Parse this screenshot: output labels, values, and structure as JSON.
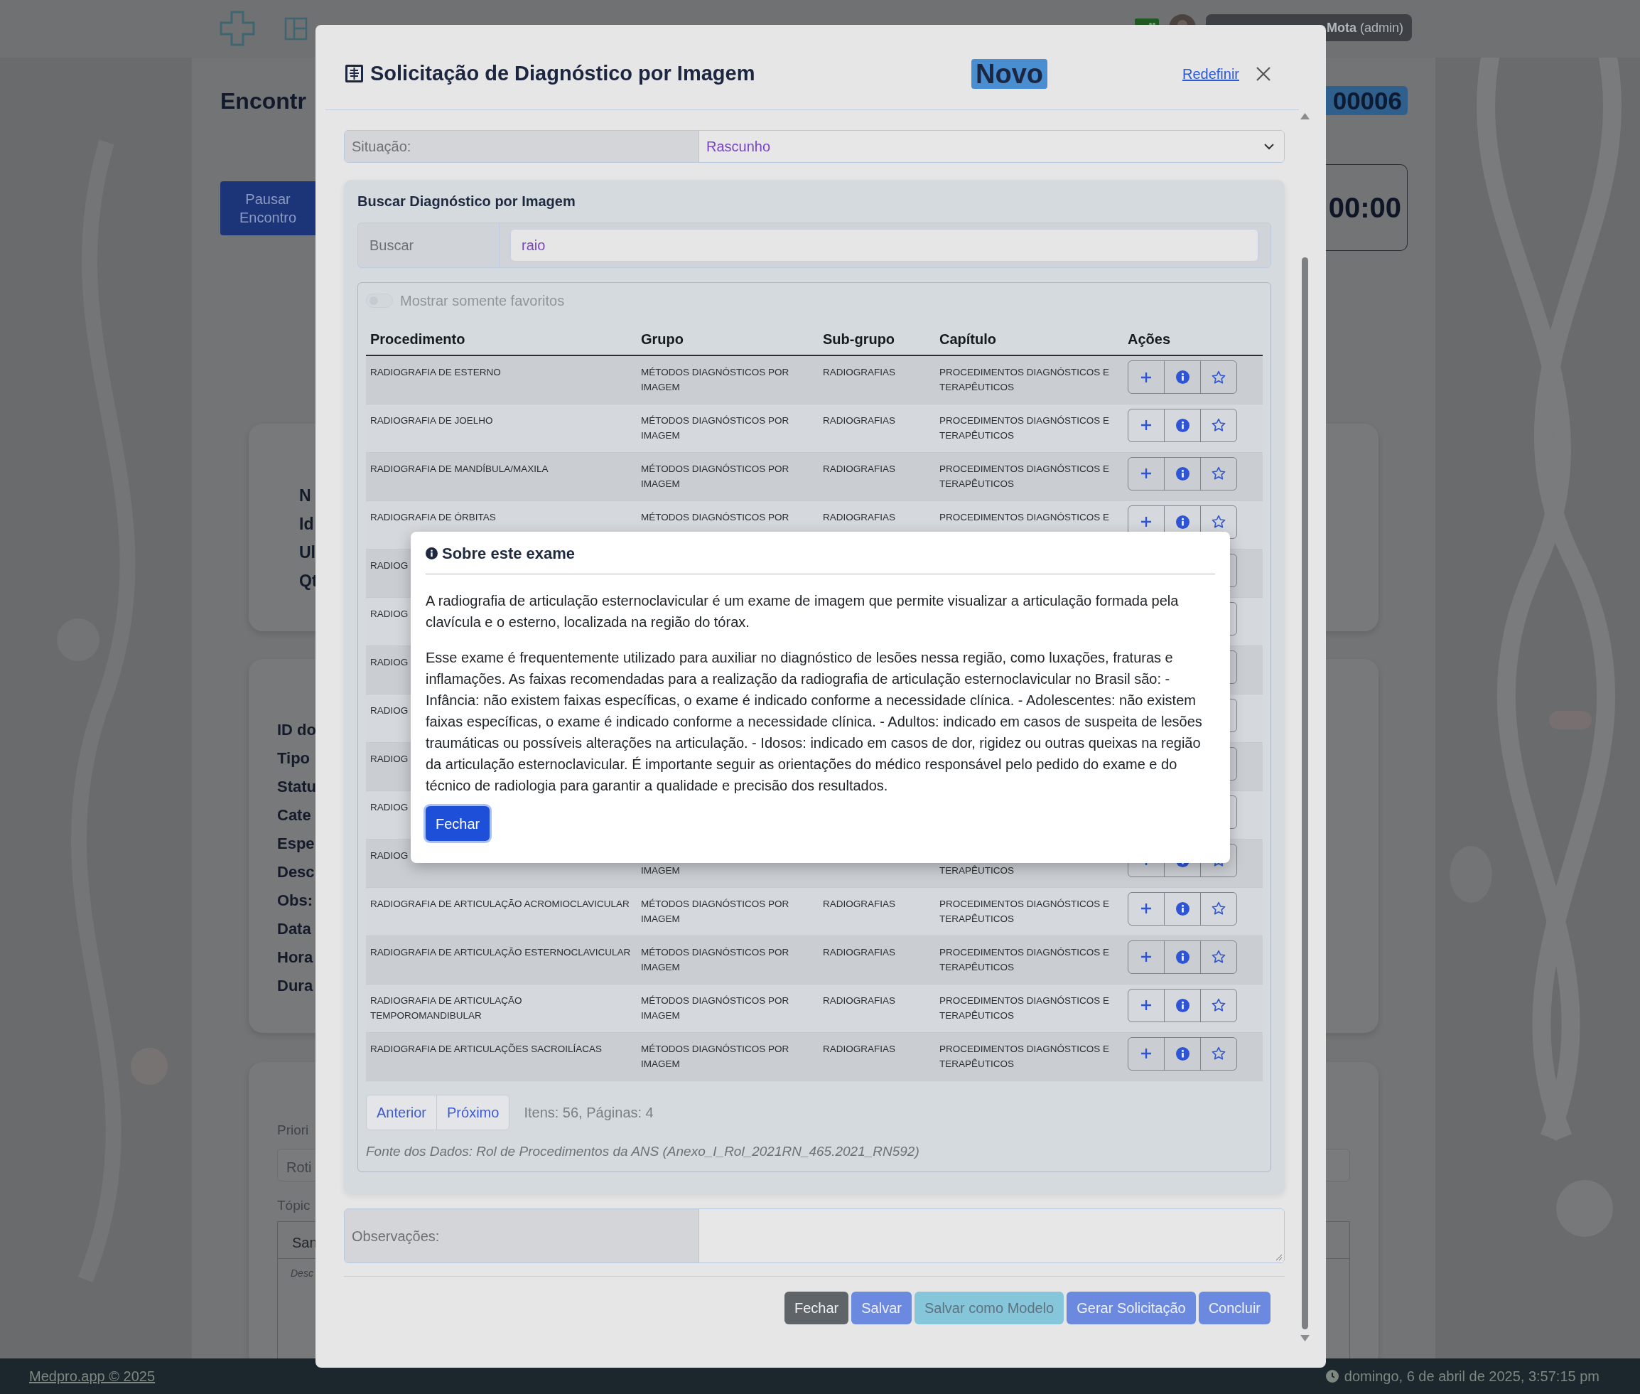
{
  "navbar": {
    "user": "**Mota** (admin)"
  },
  "page": {
    "title": "Encontr",
    "badge": "00006",
    "pause_button": "Pausar Encontro",
    "timer": "00:00",
    "patient_labels": [
      "N",
      "Id",
      "Ul",
      "Qt"
    ],
    "encounter_labels": [
      "ID do",
      "Tipo",
      "Statu",
      "Cate",
      "Espe",
      "Desc",
      "Obs:",
      "Data",
      "Hora",
      "Dura"
    ],
    "priority_label": "Priori",
    "priority_value": "Roti",
    "topics_label": "Tópic",
    "topics_header": "San",
    "topics_placeholder": "Desc"
  },
  "modal": {
    "title": "Solicitação de Diagnóstico por Imagem",
    "status_badge": "Novo",
    "reset_link": "Redefinir",
    "situacao": {
      "label": "Situação:",
      "value": "Rascunho"
    },
    "search_card": {
      "title": "Buscar Diagnóstico por Imagem",
      "search_label": "Buscar",
      "search_value": "raio",
      "favorites_toggle": {
        "label": "Mostrar somente favoritos",
        "on": false,
        "disabled": true
      },
      "table": {
        "columns": [
          "Procedimento",
          "Grupo",
          "Sub-grupo",
          "Capítulo",
          "Ações"
        ],
        "rows": [
          {
            "kind": "full",
            "procedimento": "RADIOGRAFIA DE ESTERNO",
            "grupo": "MÉTODOS DIAGNÓSTICOS POR IMAGEM",
            "subgrupo": "RADIOGRAFIAS",
            "capitulo": "PROCEDIMENTOS DIAGNÓSTICOS E TERAPÊUTICOS"
          },
          {
            "kind": "full",
            "procedimento": "RADIOGRAFIA DE JOELHO",
            "grupo": "MÉTODOS DIAGNÓSTICOS POR IMAGEM",
            "subgrupo": "RADIOGRAFIAS",
            "capitulo": "PROCEDIMENTOS DIAGNÓSTICOS E TERAPÊUTICOS"
          },
          {
            "kind": "full",
            "procedimento": "RADIOGRAFIA DE MANDÍBULA/MAXILA",
            "grupo": "MÉTODOS DIAGNÓSTICOS POR IMAGEM",
            "subgrupo": "RADIOGRAFIAS",
            "capitulo": "PROCEDIMENTOS DIAGNÓSTICOS E TERAPÊUTICOS"
          },
          {
            "kind": "full",
            "procedimento": "RADIOGRAFIA DE ÓRBITAS",
            "grupo": "MÉTODOS DIAGNÓSTICOS POR",
            "subgrupo": "RADIOGRAFIAS",
            "capitulo": "PROCEDIMENTOS DIAGNÓSTICOS E"
          },
          {
            "kind": "covered",
            "procedimento": "RADIOG"
          },
          {
            "kind": "covered",
            "procedimento": "RADIOG"
          },
          {
            "kind": "covered",
            "procedimento": "RADIOG"
          },
          {
            "kind": "covered",
            "procedimento": "RADIOG"
          },
          {
            "kind": "covered",
            "procedimento": "RADIOG"
          },
          {
            "kind": "covered",
            "procedimento": "RADIOG"
          },
          {
            "kind": "covered",
            "procedimento": "RADIOG",
            "grupo": "IMAGEM",
            "capitulo": "TERAPÊUTICOS"
          },
          {
            "kind": "full",
            "procedimento": "RADIOGRAFIA DE ARTICULAÇÃO ACROMIOCLAVICULAR",
            "grupo": "MÉTODOS DIAGNÓSTICOS POR IMAGEM",
            "subgrupo": "RADIOGRAFIAS",
            "capitulo": "PROCEDIMENTOS DIAGNÓSTICOS E TERAPÊUTICOS"
          },
          {
            "kind": "full",
            "procedimento": "RADIOGRAFIA DE ARTICULAÇÃO ESTERNOCLAVICULAR",
            "grupo": "MÉTODOS DIAGNÓSTICOS POR IMAGEM",
            "subgrupo": "RADIOGRAFIAS",
            "capitulo": "PROCEDIMENTOS DIAGNÓSTICOS E TERAPÊUTICOS"
          },
          {
            "kind": "full",
            "procedimento": "RADIOGRAFIA DE ARTICULAÇÃO TEMPOROMANDIBULAR",
            "grupo": "MÉTODOS DIAGNÓSTICOS POR IMAGEM",
            "subgrupo": "RADIOGRAFIAS",
            "capitulo": "PROCEDIMENTOS DIAGNÓSTICOS E TERAPÊUTICOS"
          },
          {
            "kind": "full",
            "procedimento": "RADIOGRAFIA DE ARTICULAÇÕES SACROILÍACAS",
            "grupo": "MÉTODOS DIAGNÓSTICOS POR IMAGEM",
            "subgrupo": "RADIOGRAFIAS",
            "capitulo": "PROCEDIMENTOS DIAGNÓSTICOS E TERAPÊUTICOS"
          }
        ]
      },
      "pagination": {
        "buttons": [
          "Anterior",
          "Próximo"
        ],
        "summary": "Itens: 56, Páginas: 4"
      },
      "source": "Fonte dos Dados: Rol de Procedimentos da ANS (Anexo_I_Rol_2021RN_465.2021_RN592)"
    },
    "observacoes": {
      "label": "Observações:"
    },
    "buttons": [
      {
        "label": "Fechar",
        "kind": "secondary"
      },
      {
        "label": "Salvar",
        "kind": "primary"
      },
      {
        "label": "Salvar como Modelo",
        "kind": "info"
      },
      {
        "label": "Gerar Solicitação",
        "kind": "primary"
      },
      {
        "label": "Concluir",
        "kind": "primary"
      }
    ]
  },
  "info_dialog": {
    "title": "Sobre este exame",
    "paragraphs": [
      "A radiografia de articulação esternoclavicular é um exame de imagem que permite visualizar a articulação formada pela clavícula e o esterno, localizada na região do tórax.",
      "Esse exame é frequentemente utilizado para auxiliar no diagnóstico de lesões nessa região, como luxações, fraturas e inflamações. As faixas recomendadas para a realização da radiografia de articulação esternoclavicular no Brasil são: - Infância: não existem faixas específicas, o exame é indicado conforme a necessidade clínica. - Adolescentes: não existem faixas específicas, o exame é indicado conforme a necessidade clínica. - Adultos: indicado em casos de suspeita de lesões traumáticas ou possíveis alterações na articulação. - Idosos: indicado em casos de dor, rigidez ou outras queixas na região da articulação esternoclavicular. É importante seguir as orientações do médico responsável pelo pedido do exame e do técnico de radiologia para garantir a qualidade e precisão dos resultados."
    ],
    "close_button": "Fechar"
  },
  "footer": {
    "link": "Medpro.app © 2025",
    "datetime": "domingo, 6 de abril de 2025, 3:57:15 pm"
  }
}
